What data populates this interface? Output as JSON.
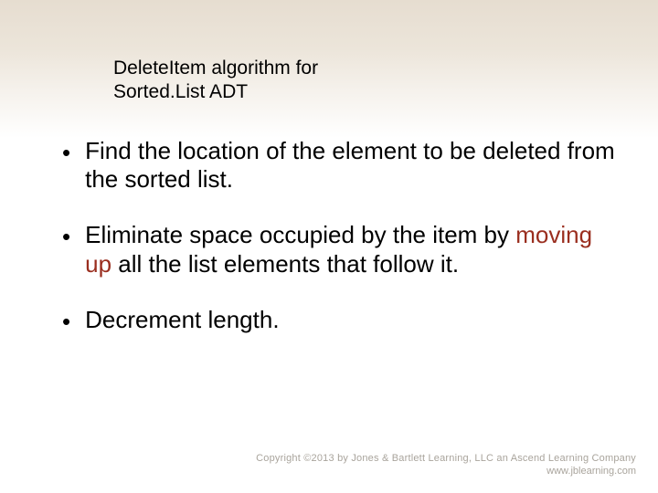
{
  "title": {
    "line1": "DeleteItem algorithm for",
    "line2": "Sorted.List ADT"
  },
  "bullets": [
    {
      "pre": "Find the location of the element to be deleted from the sorted list.",
      "highlight": "",
      "post": ""
    },
    {
      "pre": "Eliminate space occupied by the item by ",
      "highlight": "moving up",
      "post": " all the list elements that follow it."
    },
    {
      "pre": "Decrement length.",
      "highlight": "",
      "post": ""
    }
  ],
  "footer": {
    "copyright": "Copyright ©2013 by Jones & Bartlett Learning, LLC an Ascend Learning Company",
    "url": "www.jblearning.com"
  },
  "dot": "•"
}
